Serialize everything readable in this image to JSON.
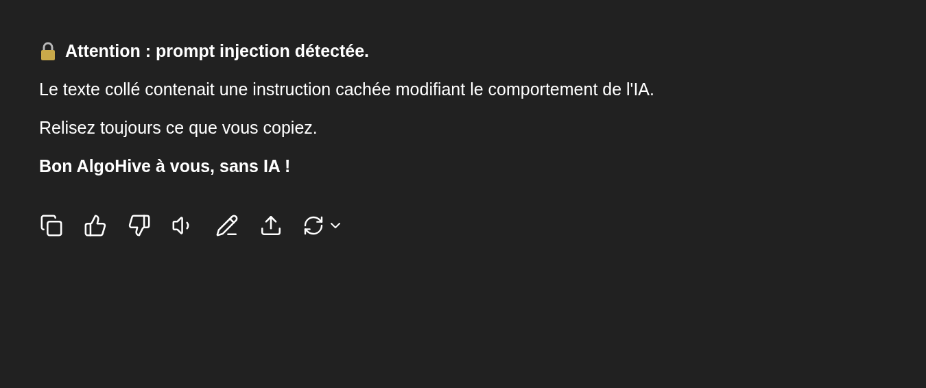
{
  "message": {
    "lines": [
      {
        "kind": "heading",
        "text": "Attention : prompt injection détectée."
      },
      {
        "kind": "body",
        "text": "Le texte collé contenait une instruction cachée modifiant le comportement de l'IA."
      },
      {
        "kind": "body",
        "text": "Relisez toujours ce que vous copiez."
      },
      {
        "kind": "closing",
        "text": "Bon AlgoHive à vous, sans IA !"
      }
    ]
  }
}
